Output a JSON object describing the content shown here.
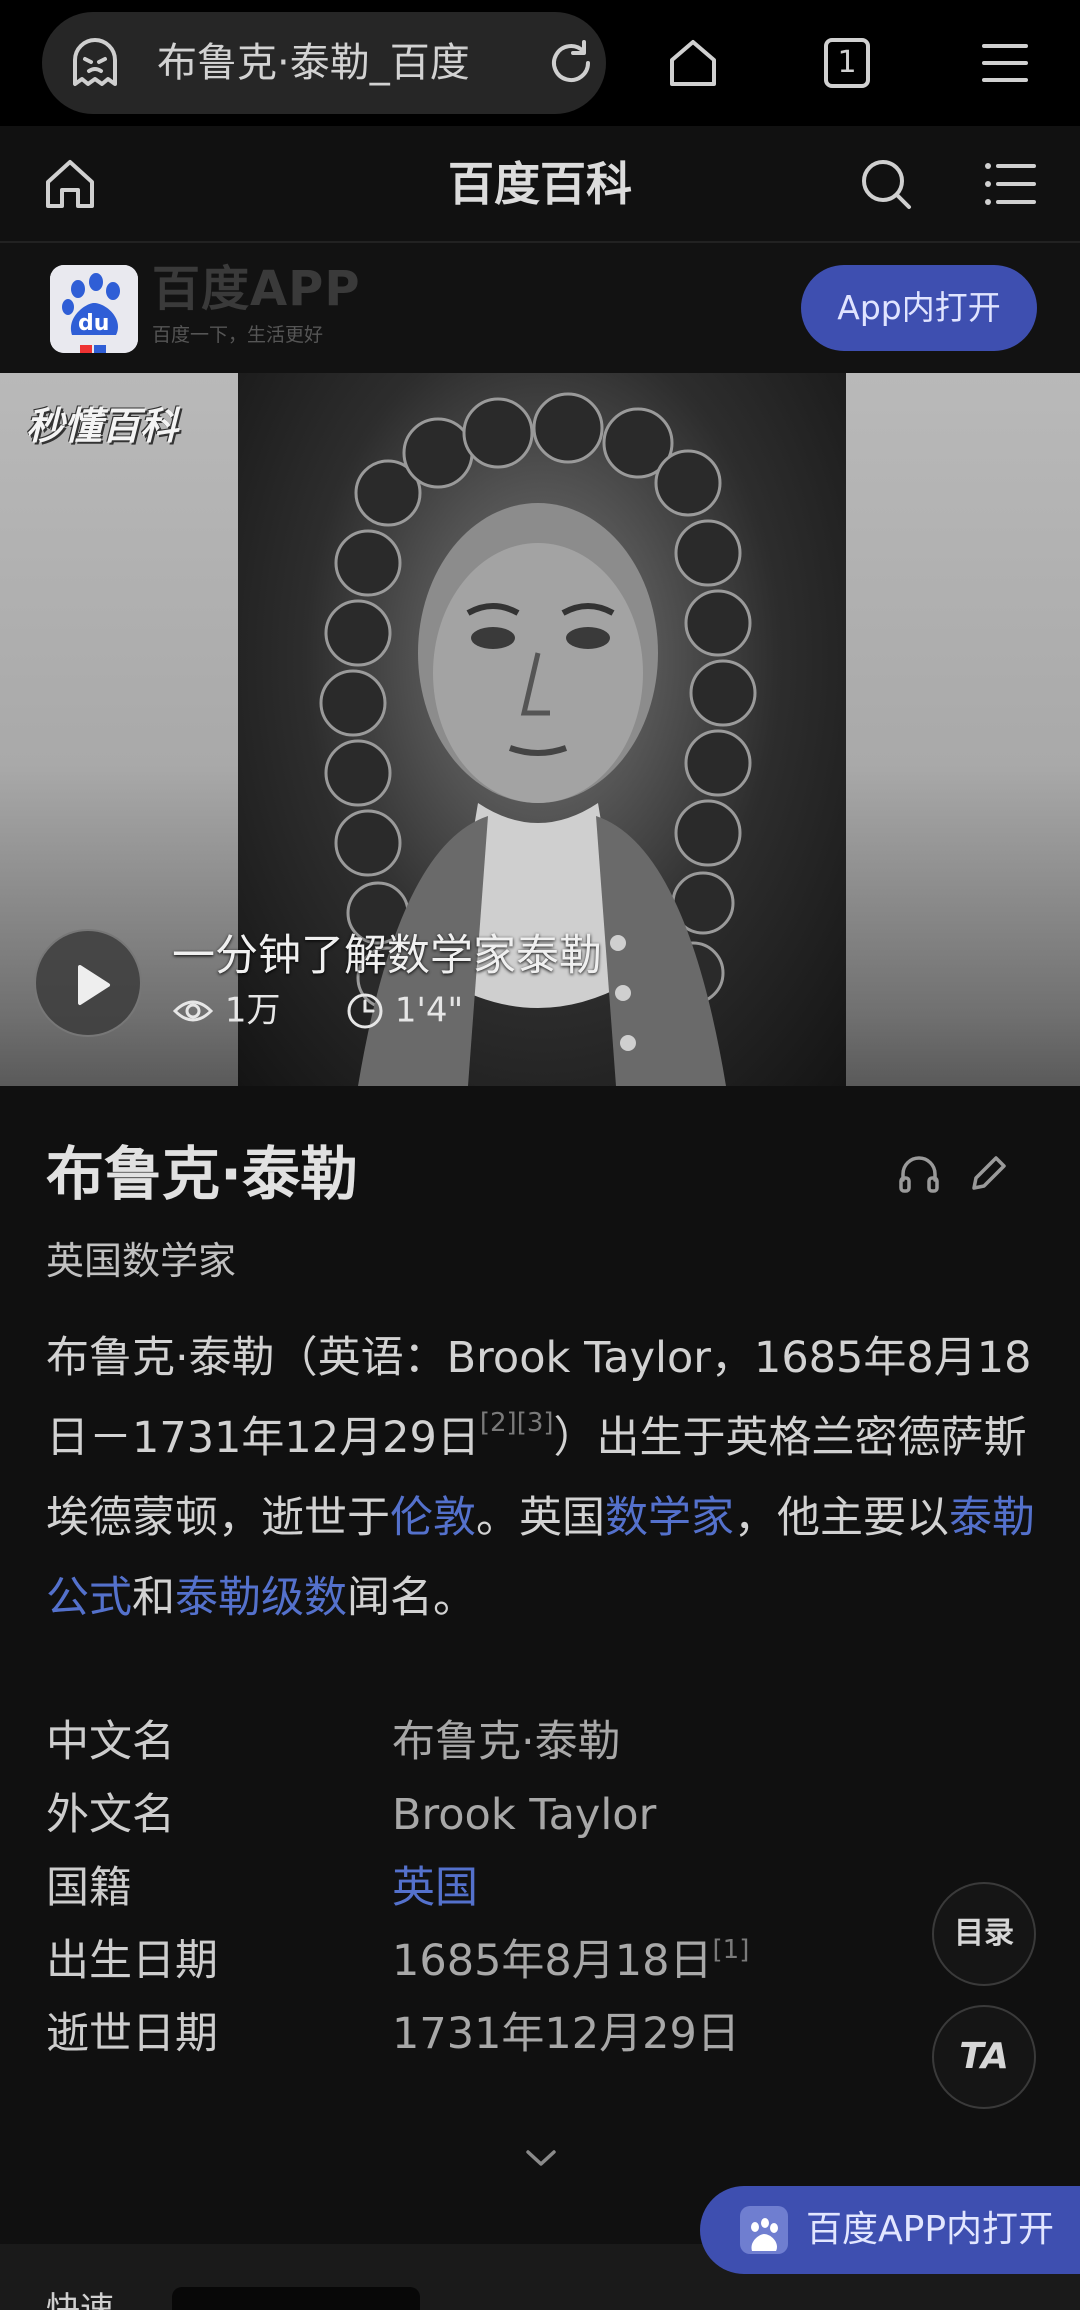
{
  "browser": {
    "url_text": "布鲁克·泰勒_百度",
    "tab_count": "1",
    "icons": [
      "ghost-icon",
      "reload-icon",
      "home-icon",
      "tabs-icon",
      "menu-icon"
    ]
  },
  "header": {
    "title": "百度百科",
    "icons": [
      "home-icon",
      "search-icon",
      "list-icon"
    ]
  },
  "app_banner": {
    "app_name": "百度APP",
    "logo_text": "du",
    "slogan": "百度一下，生活更好",
    "open_button": "App内打开"
  },
  "video": {
    "watermark": "秒懂百科",
    "title": "一分钟了解数学家泰勒",
    "views": "1万",
    "duration": "1'4\""
  },
  "article": {
    "name": "布鲁克·泰勒",
    "description": "英国数学家",
    "summary": {
      "p1": "布鲁克·泰勒（英语：Brook Taylor，1685年8月18日－1731年12月29日",
      "ref1": "[2][3]",
      "p2": "）出生于英格兰密德萨斯埃德蒙顿，逝世于",
      "link_london": "伦敦",
      "p3": "。英国",
      "link_mathematician": "数学家",
      "p4": "，他主要以",
      "link_taylor_formula": "泰勒公式",
      "p5": "和",
      "link_taylor_series": "泰勒级数",
      "p6": "闻名。"
    },
    "info": [
      {
        "label": "中文名",
        "value": "布鲁克·泰勒"
      },
      {
        "label": "外文名",
        "value": "Brook Taylor"
      },
      {
        "label": "国籍",
        "value": "英国"
      },
      {
        "label": "出生日期",
        "value": "1685年8月18日",
        "ref": "[1]"
      },
      {
        "label": "逝世日期",
        "value": "1731年12月29日"
      }
    ]
  },
  "floating": {
    "toc": "目录",
    "font": "TA"
  },
  "bottom": {
    "quick_label": "快速",
    "open_app": "百度APP内打开"
  }
}
